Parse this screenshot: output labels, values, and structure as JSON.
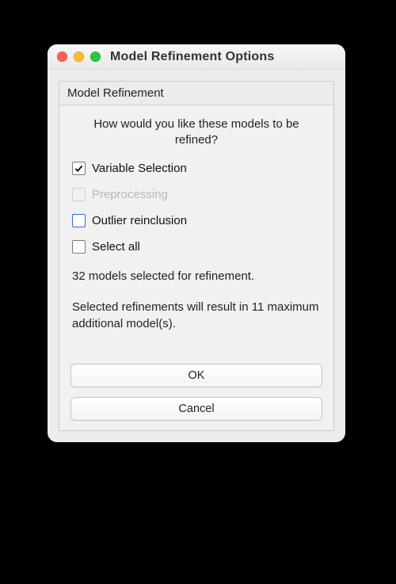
{
  "window": {
    "title": "Model Refinement Options"
  },
  "panel": {
    "header": "Model Refinement",
    "question": "How would you like these models to be refined?"
  },
  "options": {
    "variable_selection": {
      "label": "Variable Selection",
      "checked": true,
      "enabled": true
    },
    "preprocessing": {
      "label": "Preprocessing",
      "checked": false,
      "enabled": false
    },
    "outlier_reinclusion": {
      "label": "Outlier reinclusion",
      "checked": false,
      "enabled": true
    },
    "select_all": {
      "label": "Select all",
      "checked": false,
      "enabled": true
    }
  },
  "status": {
    "selected_count_line": "32 models selected for refinement.",
    "result_line": "Selected refinements will result in 11 maximum additional model(s)."
  },
  "buttons": {
    "ok": "OK",
    "cancel": "Cancel"
  },
  "colors": {
    "accent": "#2f6fe0"
  }
}
